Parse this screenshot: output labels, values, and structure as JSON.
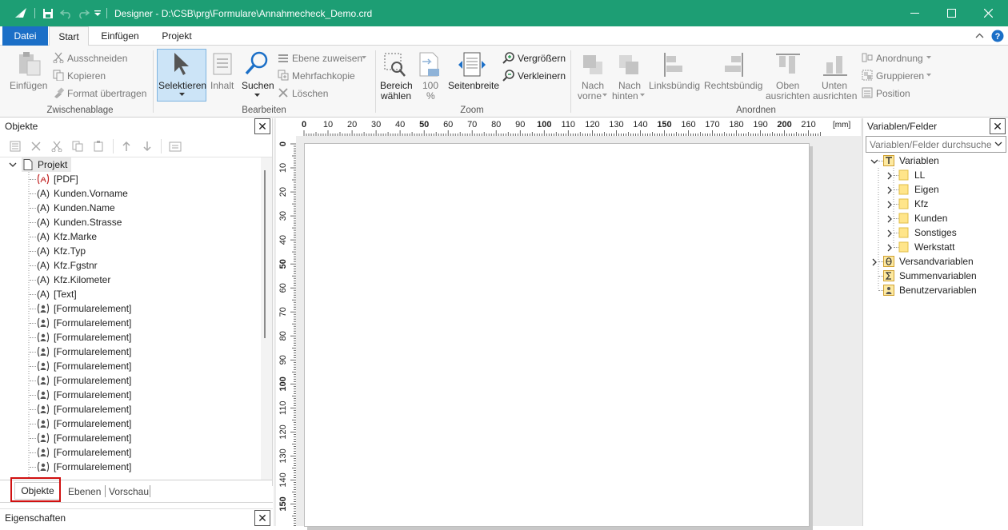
{
  "window": {
    "title": "Designer - D:\\CSB\\prg\\Formulare\\Annahmecheck_Demo.crd",
    "qat_dropdown_icon": "chevron-down-icon"
  },
  "menu_tabs": [
    {
      "label": "Datei",
      "active": false,
      "file": true
    },
    {
      "label": "Start",
      "active": true
    },
    {
      "label": "Einfügen",
      "active": false
    },
    {
      "label": "Projekt",
      "active": false
    }
  ],
  "ribbon": {
    "clipboard": {
      "paste": "Einfügen",
      "cut": "Ausschneiden",
      "copy": "Kopieren",
      "format_painter": "Format übertragen",
      "group": "Zwischenablage"
    },
    "edit": {
      "select": "Selektieren",
      "content": "Inhalt",
      "search": "Suchen",
      "assign_layer": "Ebene zuweisen",
      "multi_copy": "Mehrfachkopie",
      "delete": "Löschen",
      "group": "Bearbeiten"
    },
    "zoom": {
      "area_line1": "Bereich",
      "area_line2": "wählen",
      "hundred_line1": "100",
      "hundred_line2": "%",
      "page_width": "Seitenbreite",
      "zoom_in": "Vergrößern",
      "zoom_out": "Verkleinern",
      "group": "Zoom"
    },
    "arrange": {
      "front_line1": "Nach",
      "front_line2": "vorne",
      "back_line1": "Nach",
      "back_line2": "hinten",
      "left_align": "Linksbündig",
      "right_align": "Rechtsbündig",
      "top_line1": "Oben",
      "top_line2": "ausrichten",
      "bottom_line1": "Unten",
      "bottom_line2": "ausrichten",
      "order": "Anordnung",
      "grouping": "Gruppieren",
      "position": "Position",
      "group": "Anordnen"
    }
  },
  "objects_panel": {
    "title": "Objekte",
    "root": "Projekt",
    "items": [
      {
        "prefix": "",
        "label": "[PDF]",
        "kind": "pdf-icon"
      },
      {
        "prefix": "(A)",
        "label": "Kunden.Vorname",
        "kind": "text"
      },
      {
        "prefix": "(A)",
        "label": "Kunden.Name",
        "kind": "text"
      },
      {
        "prefix": "(A)",
        "label": "Kunden.Strasse",
        "kind": "text"
      },
      {
        "prefix": "(A)",
        "label": "Kfz.Marke",
        "kind": "text"
      },
      {
        "prefix": "(A)",
        "label": "Kfz.Typ",
        "kind": "text"
      },
      {
        "prefix": "(A)",
        "label": "Kfz.Fgstnr",
        "kind": "text"
      },
      {
        "prefix": "(A)",
        "label": "Kfz.Kilometer",
        "kind": "text"
      },
      {
        "prefix": "(A)",
        "label": "[Text]",
        "kind": "text"
      },
      {
        "prefix": "",
        "label": "[Formularelement]",
        "kind": "form"
      },
      {
        "prefix": "",
        "label": "[Formularelement]",
        "kind": "form"
      },
      {
        "prefix": "",
        "label": "[Formularelement]",
        "kind": "form"
      },
      {
        "prefix": "",
        "label": "[Formularelement]",
        "kind": "form"
      },
      {
        "prefix": "",
        "label": "[Formularelement]",
        "kind": "form"
      },
      {
        "prefix": "",
        "label": "[Formularelement]",
        "kind": "form"
      },
      {
        "prefix": "",
        "label": "[Formularelement]",
        "kind": "form"
      },
      {
        "prefix": "",
        "label": "[Formularelement]",
        "kind": "form"
      },
      {
        "prefix": "",
        "label": "[Formularelement]",
        "kind": "form"
      },
      {
        "prefix": "",
        "label": "[Formularelement]",
        "kind": "form"
      },
      {
        "prefix": "",
        "label": "[Formularelement]",
        "kind": "form"
      },
      {
        "prefix": "",
        "label": "[Formularelement]",
        "kind": "form"
      }
    ],
    "tabs": [
      "Objekte",
      "Ebenen",
      "Vorschau"
    ]
  },
  "properties_panel": {
    "title": "Eigenschaften"
  },
  "ruler": {
    "h_labels": [
      "0",
      "10",
      "20",
      "30",
      "40",
      "50",
      "60",
      "70",
      "80",
      "90",
      "100",
      "110",
      "120",
      "130",
      "140",
      "150",
      "160",
      "170",
      "180",
      "190",
      "200",
      "210"
    ],
    "unit": "[mm]",
    "v_labels": [
      "0",
      "10",
      "20",
      "30",
      "40",
      "50",
      "60",
      "70",
      "80",
      "90",
      "100",
      "110",
      "120",
      "130",
      "140",
      "150"
    ]
  },
  "variables_panel": {
    "title": "Variablen/Felder",
    "search_placeholder": "Variablen/Felder durchsuchen",
    "tree": [
      {
        "label": "Variablen",
        "level": 0,
        "icon": "text-var-icon"
      },
      {
        "label": "LL",
        "level": 1,
        "icon": "folder-icon"
      },
      {
        "label": "Eigen",
        "level": 1,
        "icon": "folder-icon"
      },
      {
        "label": "Kfz",
        "level": 1,
        "icon": "folder-icon"
      },
      {
        "label": "Kunden",
        "level": 1,
        "icon": "folder-icon"
      },
      {
        "label": "Sonstiges",
        "level": 1,
        "icon": "folder-icon"
      },
      {
        "label": "Werkstatt",
        "level": 1,
        "icon": "folder-icon"
      },
      {
        "label": "Versandvariablen",
        "level": 0,
        "icon": "theta-icon"
      },
      {
        "label": "Summenvariablen",
        "level": 0,
        "icon": "sigma-icon"
      },
      {
        "label": "Benutzervariablen",
        "level": 0,
        "icon": "user-var-icon"
      }
    ]
  },
  "colors": {
    "titlebar": "#1d9e74",
    "file_tab": "#1b6fc7",
    "select_active": "#cce4f7",
    "highlight_box": "#d01010"
  }
}
